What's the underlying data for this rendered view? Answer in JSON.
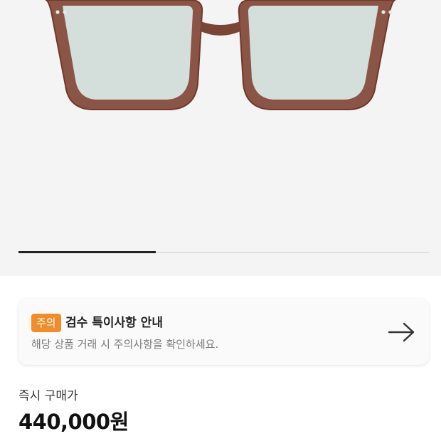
{
  "hero": {
    "image_icon": "eyeglasses-product-image",
    "carousel": {
      "current": 1,
      "total": 3
    },
    "background_color": "#f4f4f4"
  },
  "notice": {
    "badge": "주의",
    "badge_color": "#f28c28",
    "title": "검수 특이사항 안내",
    "description": "해당 상품 거래 시 주의사항을 확인하세요.",
    "arrow_icon": "arrow-right-icon"
  },
  "price": {
    "label": "즉시 구매가",
    "value": "440,000원"
  }
}
